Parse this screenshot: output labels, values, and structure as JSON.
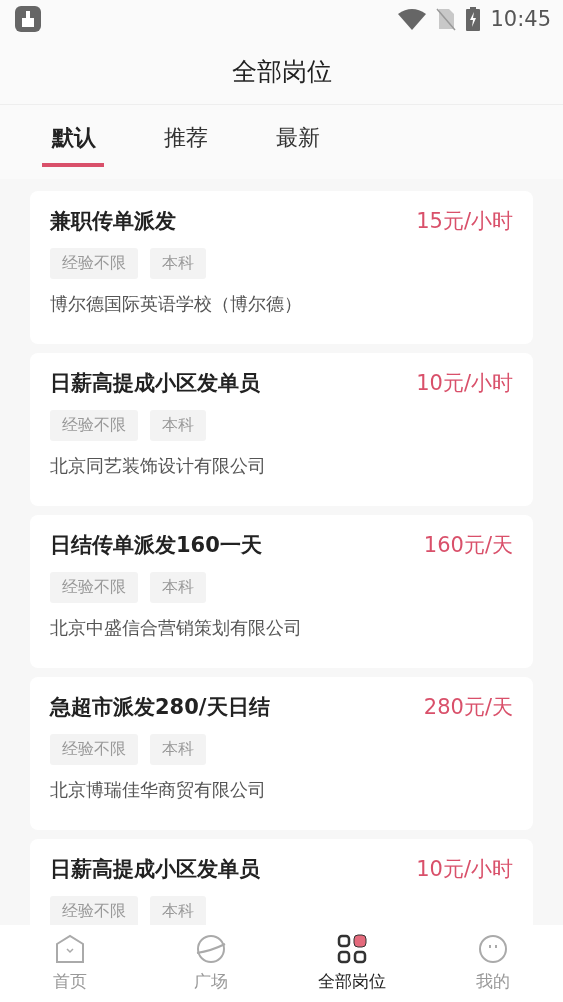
{
  "status_bar": {
    "time": "10:45"
  },
  "header": {
    "title": "全部岗位"
  },
  "tabs": [
    {
      "label": "默认",
      "selected": true
    },
    {
      "label": "推荐",
      "selected": false
    },
    {
      "label": "最新",
      "selected": false
    }
  ],
  "jobs": [
    {
      "title": "兼职传单派发",
      "salary": "15元/小时",
      "tags": [
        "经验不限",
        "本科"
      ],
      "company": "博尔德国际英语学校（博尔德）"
    },
    {
      "title": "日薪高提成小区发单员",
      "salary": "10元/小时",
      "tags": [
        "经验不限",
        "本科"
      ],
      "company": "北京同艺装饰设计有限公司"
    },
    {
      "title": "日结传单派发160一天",
      "salary": "160元/天",
      "tags": [
        "经验不限",
        "本科"
      ],
      "company": "北京中盛信合营销策划有限公司"
    },
    {
      "title": "急超市派发280/天日结",
      "salary": "280元/天",
      "tags": [
        "经验不限",
        "本科"
      ],
      "company": "北京博瑞佳华商贸有限公司"
    },
    {
      "title": "日薪高提成小区发单员",
      "salary": "10元/小时",
      "tags": [
        "经验不限",
        "本科"
      ]
    }
  ],
  "nav": [
    {
      "label": "首页",
      "kind": "home",
      "selected": false
    },
    {
      "label": "广场",
      "kind": "planet",
      "selected": false
    },
    {
      "label": "全部岗位",
      "kind": "grid",
      "selected": true
    },
    {
      "label": "我的",
      "kind": "face",
      "selected": false
    }
  ]
}
